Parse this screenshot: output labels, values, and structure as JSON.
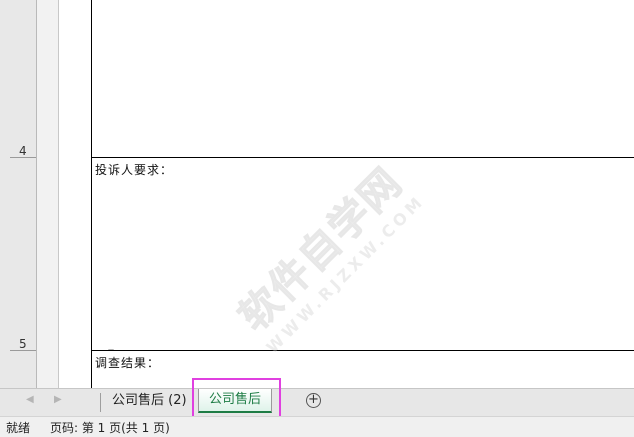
{
  "rows": {
    "row4": "4",
    "row5": "5"
  },
  "document": {
    "complaint_request_label": "投诉人要求：",
    "investigation_result_label": "调查结果："
  },
  "watermark": {
    "main": "软件自学网",
    "sub": "WWW.RJZXW.COM"
  },
  "tabs": {
    "nav_prev": "◀",
    "nav_next": "▶",
    "sheet1": "公司售后 (2)",
    "sheet2_active": "公司售后",
    "add_icon": "⊕"
  },
  "status": {
    "ready": "就绪",
    "page_info": "页码: 第 1 页(共 1 页)"
  },
  "colors": {
    "active_tab_text": "#1e7c45",
    "highlight_outline": "#e040e0"
  }
}
